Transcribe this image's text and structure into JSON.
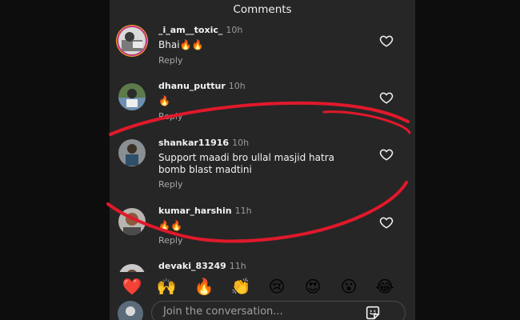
{
  "header": {
    "title": "Comments"
  },
  "comments": [
    {
      "username": "_i_am__toxic_",
      "time": "10h",
      "text": "Bhai🔥🔥",
      "reply": "Reply"
    },
    {
      "username": "dhanu_puttur",
      "time": "10h",
      "text": "🔥",
      "reply": "Reply"
    },
    {
      "username": "shankar11916",
      "time": "10h",
      "text": "Support maadi bro ullal masjid hatra bomb blast madtini",
      "reply": "Reply"
    },
    {
      "username": "kumar_harshin",
      "time": "11h",
      "text": "🔥🔥",
      "reply": "Reply"
    },
    {
      "username": "devaki_83249",
      "time": "11h",
      "text": "",
      "reply": ""
    }
  ],
  "emoji_bar": [
    "❤️",
    "🙌",
    "🔥",
    "👏",
    "😢",
    "😍",
    "😮",
    "😂"
  ],
  "compose": {
    "placeholder": "Join the conversation..."
  },
  "icons": {
    "like": "heart-outline-icon",
    "sticker": "sticker-icon"
  },
  "colors": {
    "background": "#262626",
    "annotation": "#e0192b",
    "text": "#f2f2f2",
    "muted": "#a8a8a8"
  }
}
